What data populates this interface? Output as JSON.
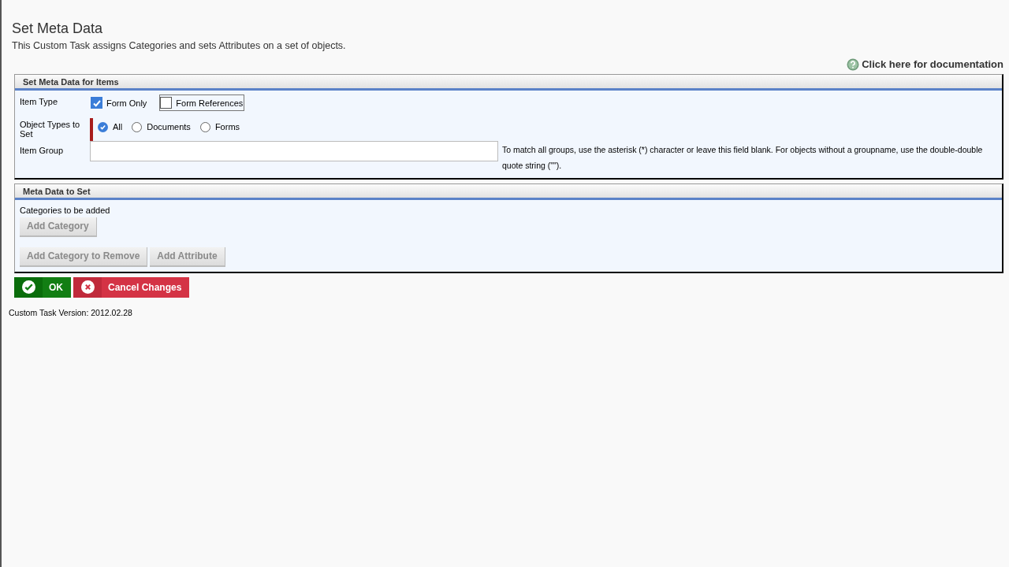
{
  "page": {
    "title": "Set Meta Data",
    "description": "This Custom Task assigns Categories and sets Attributes on a set of objects.",
    "doc_link": "Click here for documentation"
  },
  "items_section": {
    "title": "Set Meta Data for Items",
    "item_type": {
      "label": "Item Type",
      "options": [
        {
          "label": "Form Only",
          "checked": true,
          "focused": false
        },
        {
          "label": "Form References",
          "checked": false,
          "focused": true
        }
      ]
    },
    "object_types": {
      "label": "Object Types to Set",
      "required": true,
      "options": [
        {
          "label": "All",
          "selected": true
        },
        {
          "label": "Documents",
          "selected": false
        },
        {
          "label": "Forms",
          "selected": false
        }
      ]
    },
    "item_group": {
      "label": "Item Group",
      "help": "To match all groups, use the asterisk (*) character or leave this field blank. For objects without a groupname, use the double-double quote string (\"\")."
    }
  },
  "meta_section": {
    "title": "Meta Data to Set",
    "categories_label": "Categories to be added",
    "category_buttons": [
      {
        "label": "Add Category",
        "disabled": true
      }
    ],
    "other_buttons": [
      {
        "label": "Add Category to Remove",
        "disabled": true
      },
      {
        "label": "Add Attribute",
        "disabled": true
      }
    ]
  },
  "actions": [
    {
      "kind": "ok",
      "label": "OK"
    },
    {
      "kind": "cancel",
      "label": "Cancel Changes"
    }
  ],
  "version": "Custom Task Version: 2012.02.28"
}
